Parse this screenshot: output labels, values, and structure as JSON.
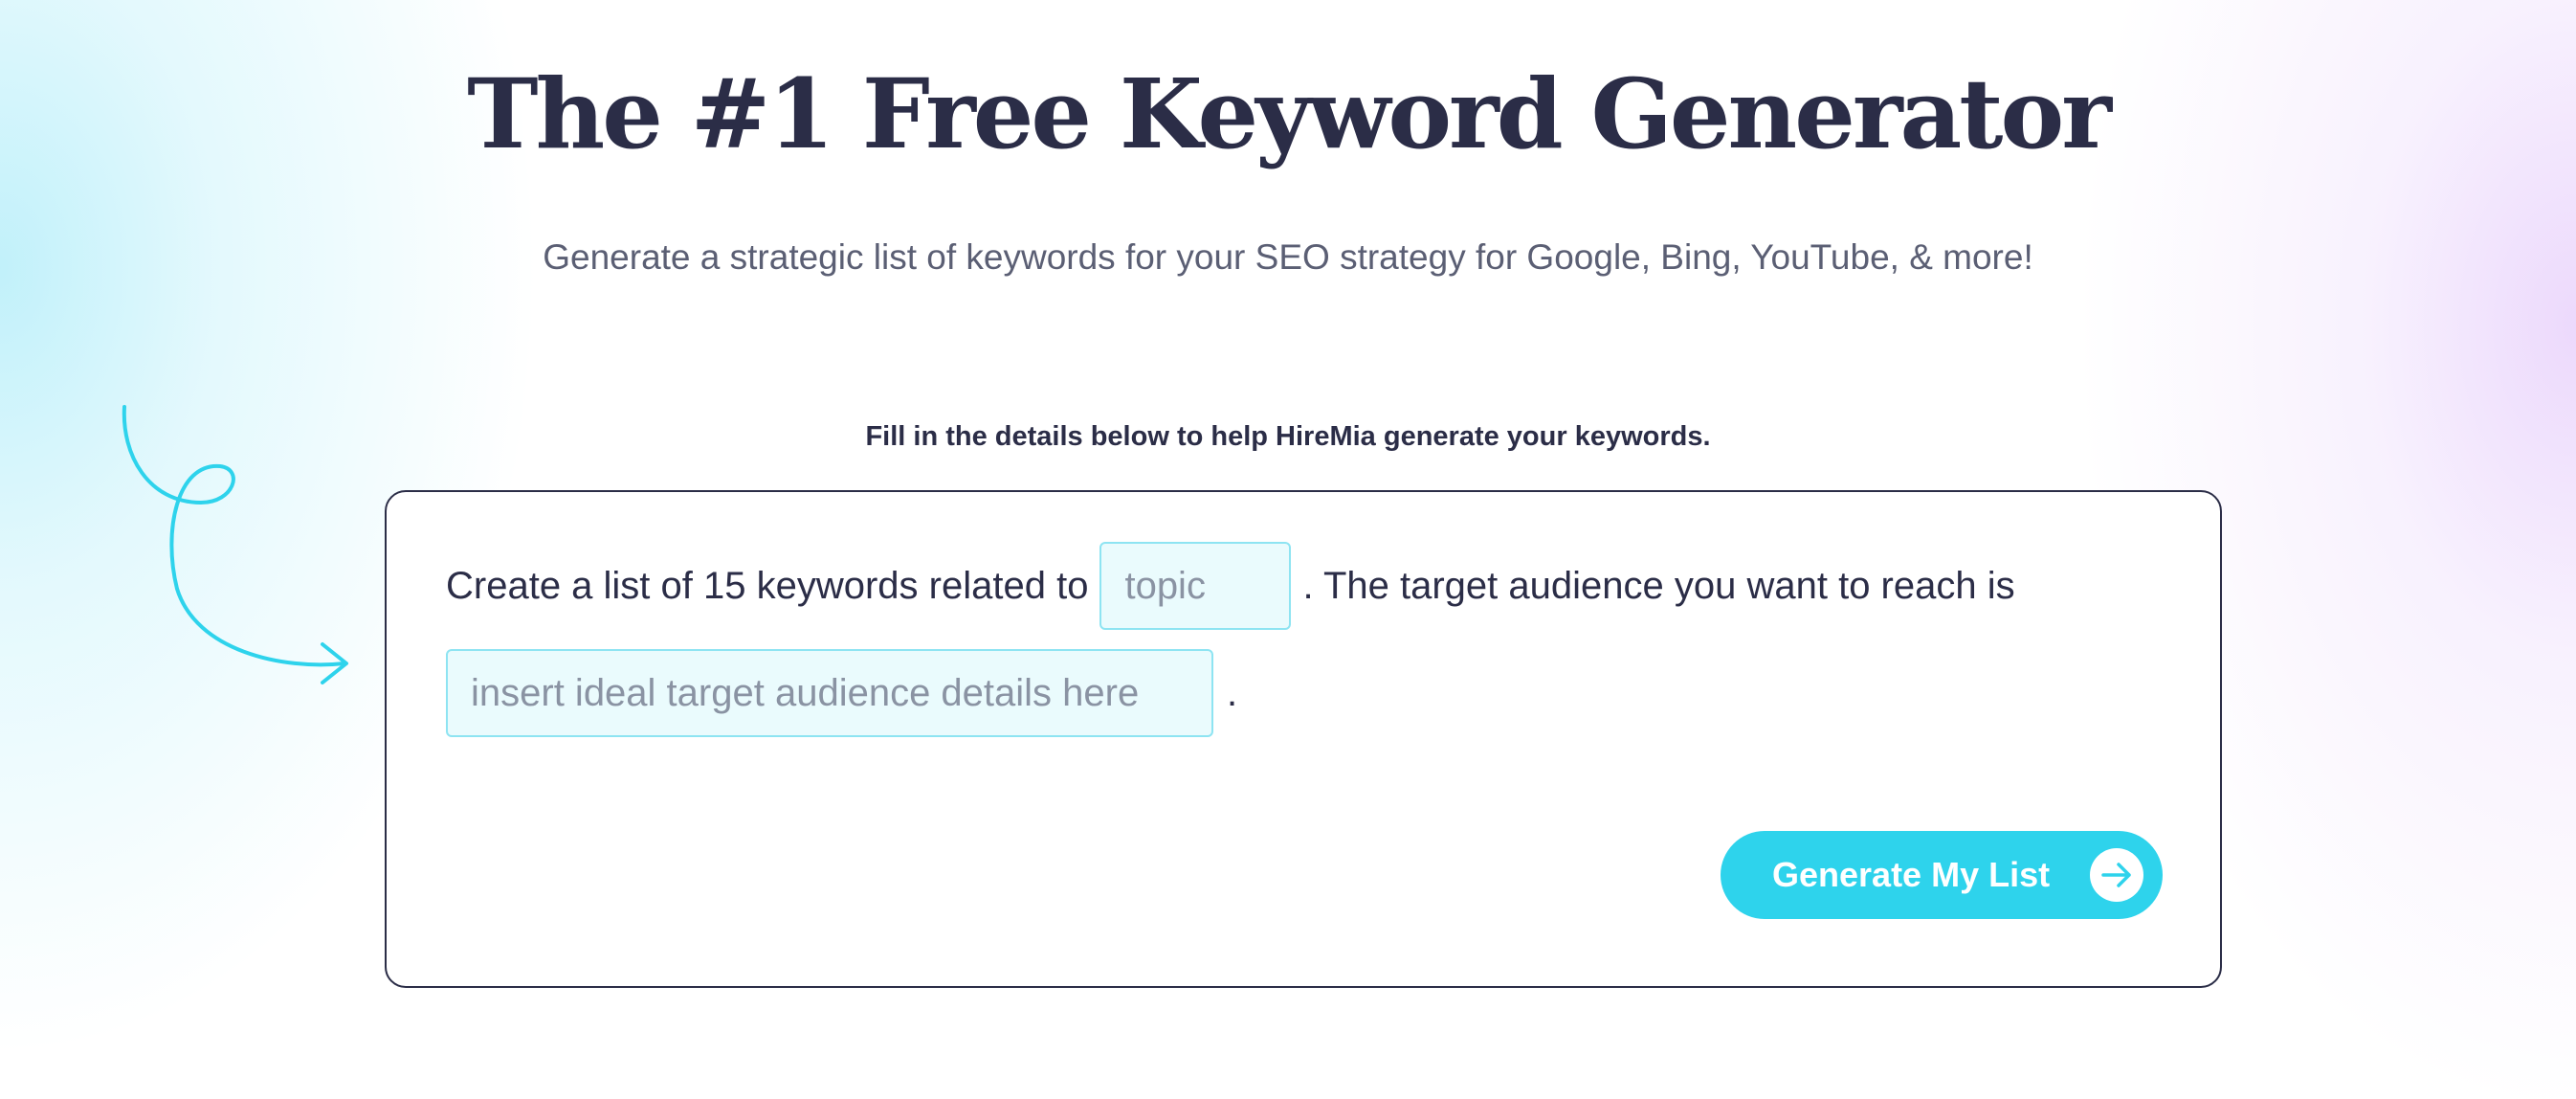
{
  "hero": {
    "title": "The #1 Free Keyword Generator",
    "subtitle": "Generate a strategic list of keywords for your SEO strategy for Google, Bing, YouTube, & more!"
  },
  "form": {
    "helper_text": "Fill in the details below to help HireMia generate your keywords.",
    "sentence_part1": "Create a list of 15 keywords related to",
    "topic_placeholder": "topic",
    "sentence_part2": ". The target audience you want to reach is",
    "audience_placeholder": "insert ideal target audience details here",
    "sentence_end": ".",
    "generate_label": "Generate My List"
  },
  "colors": {
    "accent": "#2ed3ec",
    "text_dark": "#2b2d47",
    "text_muted": "#5b5f74",
    "input_bg": "#eafbfd",
    "input_border": "#8ee4f2"
  },
  "icons": {
    "doodle": "curly-arrow-icon",
    "button": "arrow-right-circle-icon"
  }
}
